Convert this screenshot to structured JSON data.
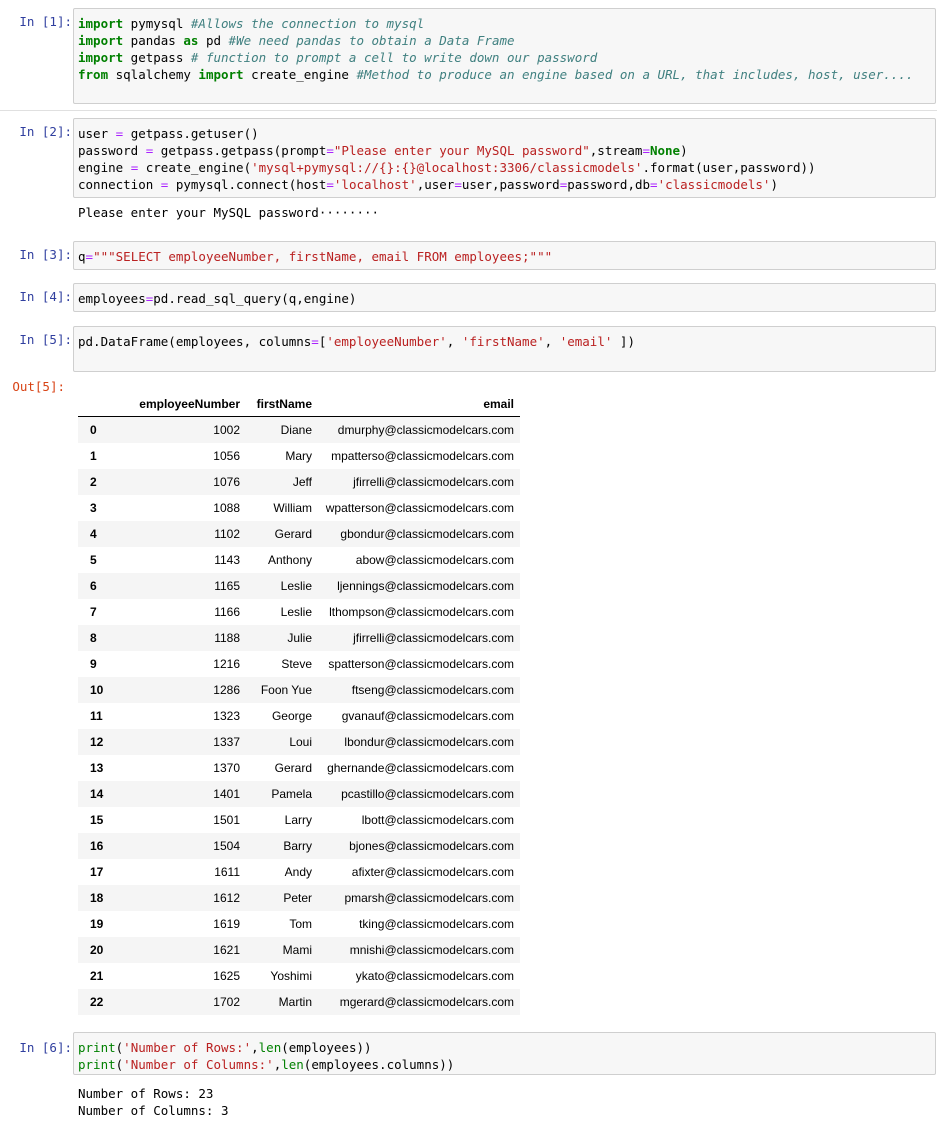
{
  "cells": [
    {
      "prompt": "In [1]:",
      "lines": [
        [
          {
            "t": "import",
            "c": "kw"
          },
          {
            "t": " pymysql ",
            "c": ""
          },
          {
            "t": "#Allows the connection to mysql",
            "c": "cm"
          }
        ],
        [
          {
            "t": "import",
            "c": "kw"
          },
          {
            "t": " pandas ",
            "c": ""
          },
          {
            "t": "as",
            "c": "kw"
          },
          {
            "t": " pd ",
            "c": ""
          },
          {
            "t": "#We need pandas to obtain a Data Frame",
            "c": "cm"
          }
        ],
        [
          {
            "t": "import",
            "c": "kw"
          },
          {
            "t": " getpass ",
            "c": ""
          },
          {
            "t": "# function to prompt a cell to write down our password",
            "c": "cm"
          }
        ],
        [
          {
            "t": "from",
            "c": "kw"
          },
          {
            "t": " sqlalchemy ",
            "c": ""
          },
          {
            "t": "import",
            "c": "kw"
          },
          {
            "t": " create_engine ",
            "c": ""
          },
          {
            "t": "#Method to produce an engine based on a URL, that includes, host, user....",
            "c": "cm"
          }
        ]
      ]
    },
    {
      "prompt": "In [2]:",
      "lines": [
        [
          {
            "t": "user ",
            "c": ""
          },
          {
            "t": "=",
            "c": "op"
          },
          {
            "t": " getpass.getuser()",
            "c": ""
          }
        ],
        [
          {
            "t": "password ",
            "c": ""
          },
          {
            "t": "=",
            "c": "op"
          },
          {
            "t": " getpass.getpass(prompt",
            "c": ""
          },
          {
            "t": "=",
            "c": "op"
          },
          {
            "t": "\"Please enter your MySQL password\"",
            "c": "st"
          },
          {
            "t": ",stream",
            "c": ""
          },
          {
            "t": "=",
            "c": "op"
          },
          {
            "t": "None",
            "c": "kw"
          },
          {
            "t": ")",
            "c": ""
          }
        ],
        [
          {
            "t": "engine ",
            "c": ""
          },
          {
            "t": "=",
            "c": "op"
          },
          {
            "t": " create_engine(",
            "c": ""
          },
          {
            "t": "'mysql+pymysql://{}:{}@localhost:3306/classicmodels'",
            "c": "st"
          },
          {
            "t": ".format(user,password))",
            "c": ""
          }
        ],
        [
          {
            "t": "connection ",
            "c": ""
          },
          {
            "t": "=",
            "c": "op"
          },
          {
            "t": " pymysql.connect(host",
            "c": ""
          },
          {
            "t": "=",
            "c": "op"
          },
          {
            "t": "'localhost'",
            "c": "st"
          },
          {
            "t": ",user",
            "c": ""
          },
          {
            "t": "=",
            "c": "op"
          },
          {
            "t": "user,password",
            "c": ""
          },
          {
            "t": "=",
            "c": "op"
          },
          {
            "t": "password,db",
            "c": ""
          },
          {
            "t": "=",
            "c": "op"
          },
          {
            "t": "'classicmodels'",
            "c": "st"
          },
          {
            "t": ")",
            "c": ""
          }
        ]
      ],
      "output": "Please enter your MySQL password········"
    },
    {
      "prompt": "In [3]:",
      "lines": [
        [
          {
            "t": "q",
            "c": ""
          },
          {
            "t": "=",
            "c": "op"
          },
          {
            "t": "\"\"\"SELECT employeeNumber, firstName, email FROM employees;\"\"\"",
            "c": "st"
          }
        ]
      ]
    },
    {
      "prompt": "In [4]:",
      "lines": [
        [
          {
            "t": "employees",
            "c": ""
          },
          {
            "t": "=",
            "c": "op"
          },
          {
            "t": "pd.read_sql_query(q,engine)",
            "c": ""
          }
        ]
      ]
    },
    {
      "prompt": "In [5]:",
      "lines": [
        [
          {
            "t": "pd.DataFrame(employees, columns",
            "c": ""
          },
          {
            "t": "=",
            "c": "op"
          },
          {
            "t": "[",
            "c": ""
          },
          {
            "t": "'employeeNumber'",
            "c": "st"
          },
          {
            "t": ", ",
            "c": ""
          },
          {
            "t": "'firstName'",
            "c": "st"
          },
          {
            "t": ", ",
            "c": ""
          },
          {
            "t": "'email'",
            "c": "st"
          },
          {
            "t": " ])",
            "c": ""
          }
        ]
      ]
    },
    {
      "prompt": "In [6]:",
      "lines": [
        [
          {
            "t": "print",
            "c": "fn"
          },
          {
            "t": "(",
            "c": ""
          },
          {
            "t": "'Number of Rows:'",
            "c": "st"
          },
          {
            "t": ",",
            "c": ""
          },
          {
            "t": "len",
            "c": "fn"
          },
          {
            "t": "(employees))",
            "c": ""
          }
        ],
        [
          {
            "t": "print",
            "c": "fn"
          },
          {
            "t": "(",
            "c": ""
          },
          {
            "t": "'Number of Columns:'",
            "c": "st"
          },
          {
            "t": ",",
            "c": ""
          },
          {
            "t": "len",
            "c": "fn"
          },
          {
            "t": "(employees.columns))",
            "c": ""
          }
        ]
      ],
      "output": "Number of Rows: 23\nNumber of Columns: 3"
    }
  ],
  "out5_prompt": "Out[5]:",
  "dataframe": {
    "columns": [
      "employeeNumber",
      "firstName",
      "email"
    ],
    "rows": [
      [
        "0",
        "1002",
        "Diane",
        "dmurphy@classicmodelcars.com"
      ],
      [
        "1",
        "1056",
        "Mary",
        "mpatterso@classicmodelcars.com"
      ],
      [
        "2",
        "1076",
        "Jeff",
        "jfirrelli@classicmodelcars.com"
      ],
      [
        "3",
        "1088",
        "William",
        "wpatterson@classicmodelcars.com"
      ],
      [
        "4",
        "1102",
        "Gerard",
        "gbondur@classicmodelcars.com"
      ],
      [
        "5",
        "1143",
        "Anthony",
        "abow@classicmodelcars.com"
      ],
      [
        "6",
        "1165",
        "Leslie",
        "ljennings@classicmodelcars.com"
      ],
      [
        "7",
        "1166",
        "Leslie",
        "lthompson@classicmodelcars.com"
      ],
      [
        "8",
        "1188",
        "Julie",
        "jfirrelli@classicmodelcars.com"
      ],
      [
        "9",
        "1216",
        "Steve",
        "spatterson@classicmodelcars.com"
      ],
      [
        "10",
        "1286",
        "Foon Yue",
        "ftseng@classicmodelcars.com"
      ],
      [
        "11",
        "1323",
        "George",
        "gvanauf@classicmodelcars.com"
      ],
      [
        "12",
        "1337",
        "Loui",
        "lbondur@classicmodelcars.com"
      ],
      [
        "13",
        "1370",
        "Gerard",
        "ghernande@classicmodelcars.com"
      ],
      [
        "14",
        "1401",
        "Pamela",
        "pcastillo@classicmodelcars.com"
      ],
      [
        "15",
        "1501",
        "Larry",
        "lbott@classicmodelcars.com"
      ],
      [
        "16",
        "1504",
        "Barry",
        "bjones@classicmodelcars.com"
      ],
      [
        "17",
        "1611",
        "Andy",
        "afixter@classicmodelcars.com"
      ],
      [
        "18",
        "1612",
        "Peter",
        "pmarsh@classicmodelcars.com"
      ],
      [
        "19",
        "1619",
        "Tom",
        "tking@classicmodelcars.com"
      ],
      [
        "20",
        "1621",
        "Mami",
        "mnishi@classicmodelcars.com"
      ],
      [
        "21",
        "1625",
        "Yoshimi",
        "ykato@classicmodelcars.com"
      ],
      [
        "22",
        "1702",
        "Martin",
        "mgerard@classicmodelcars.com"
      ]
    ]
  }
}
